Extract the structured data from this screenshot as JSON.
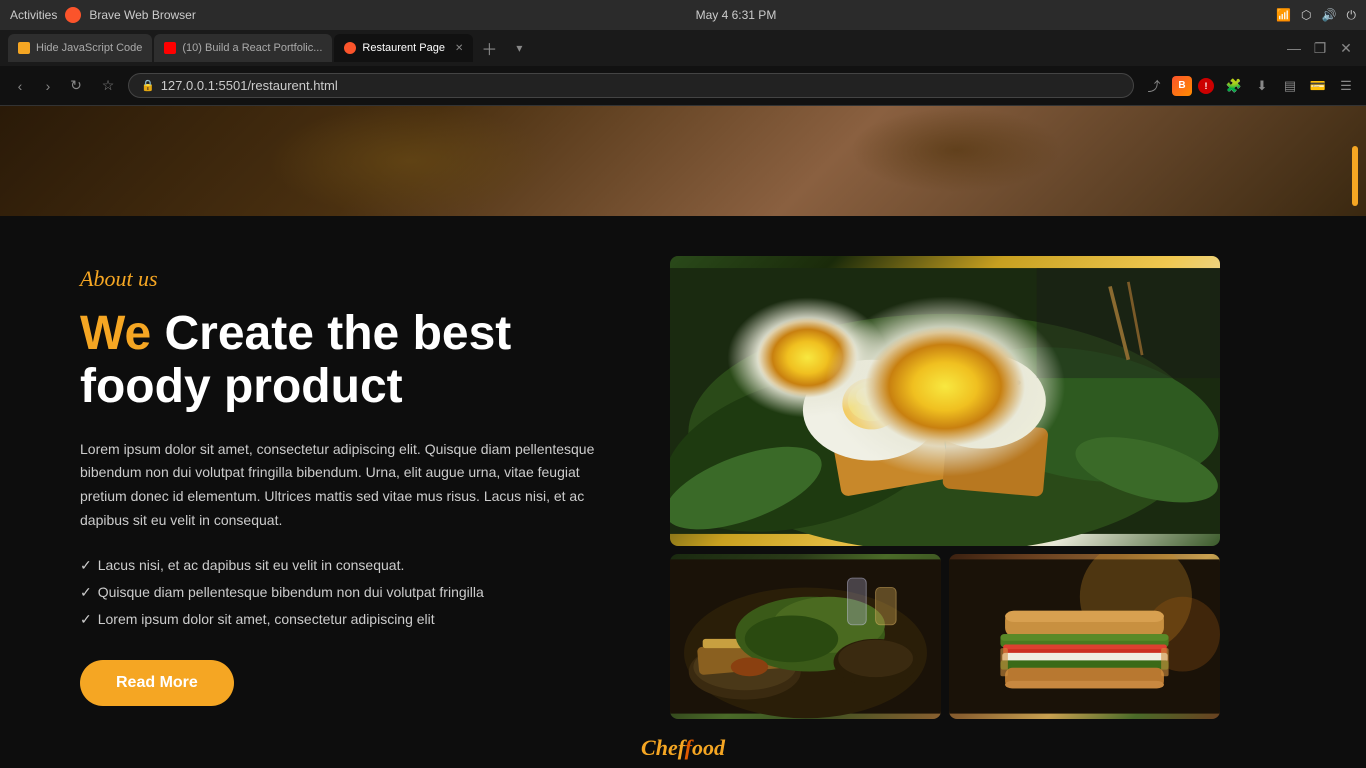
{
  "browser": {
    "title": "Brave Web Browser",
    "os_label": "Activities",
    "datetime": "May 4  6:31 PM",
    "url": "127.0.0.1:5501/restaurent.html",
    "url_display": "127.0.0.1:5501/restaurent.html",
    "tabs": [
      {
        "id": "tab1",
        "label": "Hide JavaScript Code",
        "favicon_type": "bookmark",
        "active": false
      },
      {
        "id": "tab2",
        "label": "(10) Build a React Portfolic...",
        "favicon_type": "red",
        "active": false
      },
      {
        "id": "tab3",
        "label": "Restaurent Page",
        "favicon_type": "active-favicon",
        "active": true
      }
    ],
    "nav": {
      "back": "‹",
      "forward": "›",
      "reload": "↻"
    }
  },
  "page": {
    "about": {
      "subtitle": "About us",
      "heading_highlight": "We",
      "heading_rest": " Create the best foody product",
      "description": "Lorem ipsum dolor sit amet, consectetur adipiscing elit. Quisque diam pellentesque bibendum non dui volutpat fringilla bibendum. Urna, elit augue urna, vitae feugiat pretium donec id elementum. Ultrices mattis sed vitae mus risus. Lacus nisi, et ac dapibus sit eu velit in consequat.",
      "checklist": [
        "Lacus nisi, et ac dapibus sit eu velit in consequat.",
        "Quisque diam pellentesque bibendum non dui volutpat fringilla",
        "Lorem ipsum dolor sit amet, consectetur adipiscing elit"
      ],
      "read_more_label": "Read More"
    },
    "footer_logo": "Chef"
  }
}
